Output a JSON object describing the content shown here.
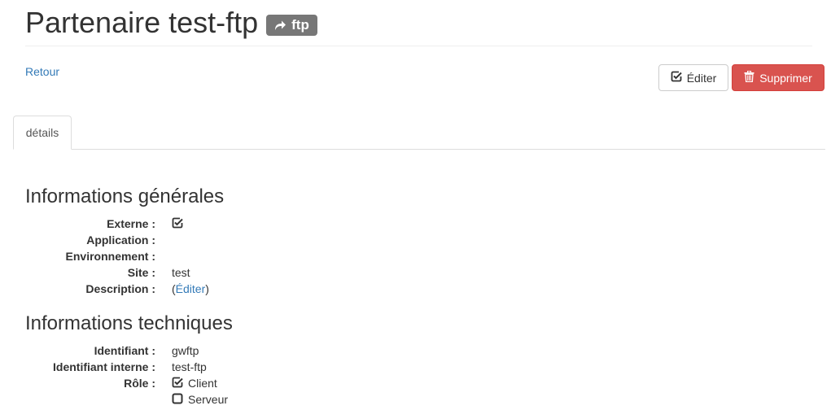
{
  "header": {
    "title": "Partenaire test-ftp",
    "badge_label": "ftp",
    "badge_icon": "share-arrow-icon"
  },
  "actions": {
    "back_label": "Retour",
    "edit_label": "Éditer",
    "edit_icon": "edit-check-icon",
    "delete_label": "Supprimer",
    "delete_icon": "trash-icon",
    "delete_color": "#d9534f"
  },
  "tabs": [
    {
      "label": "détails",
      "active": true
    }
  ],
  "general": {
    "heading": "Informations générales",
    "fields": [
      {
        "label": "Externe :",
        "checked": true
      },
      {
        "label": "Application :",
        "value": ""
      },
      {
        "label": "Environnement :",
        "value": ""
      },
      {
        "label": "Site :",
        "value": "test"
      },
      {
        "label": "Description :",
        "value_prefix": "(",
        "link": "Éditer",
        "value_suffix": ")"
      }
    ]
  },
  "technical": {
    "heading": "Informations techniques",
    "fields": [
      {
        "label": "Identifiant :",
        "value": "gwftp"
      },
      {
        "label": "Identifiant interne :",
        "value": "test-ftp"
      },
      {
        "label": "Rôle :",
        "options": [
          {
            "label": "Client",
            "checked": true
          },
          {
            "label": "Serveur",
            "checked": false
          }
        ]
      }
    ]
  }
}
